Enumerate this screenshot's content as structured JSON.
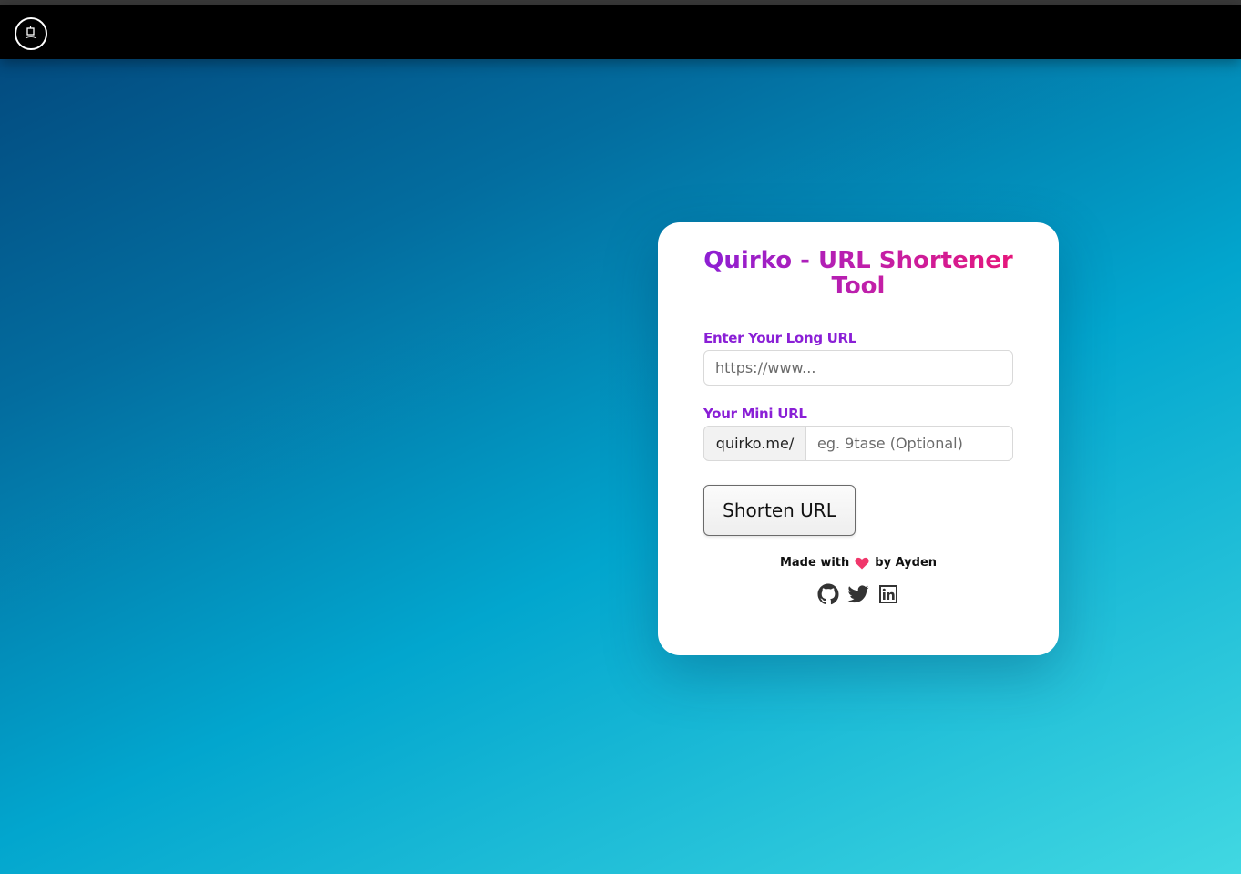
{
  "navbar": {
    "logo_icon": "quirko-logo-icon"
  },
  "card": {
    "title": "Quirko - URL Shortener Tool",
    "long_url": {
      "label": "Enter Your Long URL",
      "placeholder": "https://www...",
      "value": ""
    },
    "mini_url": {
      "label": "Your Mini URL",
      "prefix": "quirko.me/",
      "placeholder": "eg. 9tase (Optional)",
      "value": ""
    },
    "shorten_button_label": "Shorten URL",
    "footer": {
      "made_with": "Made with",
      "by": "by Ayden",
      "heart_icon": "heart-icon",
      "social_icons": [
        "github-icon",
        "twitter-icon",
        "linkedin-icon"
      ]
    }
  },
  "colors": {
    "title_gradient_start": "#8a1fd6",
    "title_gradient_end": "#e81678",
    "label": "#8a1fd6",
    "heart": "#f0376b",
    "navbar": "#000000",
    "background_start": "#03457a",
    "background_end": "#41d8e2"
  }
}
